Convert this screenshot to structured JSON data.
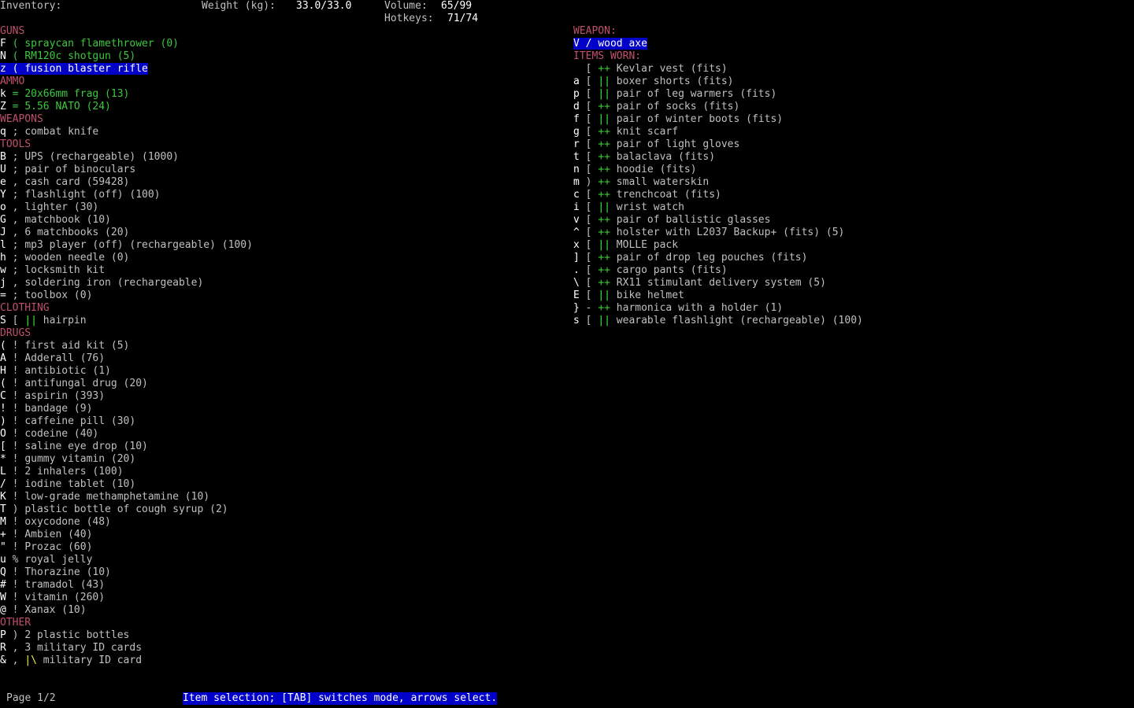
{
  "header": {
    "title": "Inventory:",
    "weight_label": "Weight (kg):",
    "weight_value": "33.0/33.0",
    "volume_label": "Volume:",
    "volume_value": "65/99",
    "hotkeys_label": "Hotkeys:",
    "hotkeys_value": "71/74"
  },
  "left": {
    "sections": [
      {
        "title": "GUNS",
        "items": [
          {
            "key": "F",
            "sym": "(",
            "text": "spraycan flamethrower (0)",
            "style": "green"
          },
          {
            "key": "N",
            "sym": "(",
            "text": "RM120c shotgun (5)",
            "style": "green"
          },
          {
            "key": "z",
            "sym": "(",
            "text": "fusion blaster rifle",
            "style": "selected"
          }
        ]
      },
      {
        "title": "AMMO",
        "items": [
          {
            "key": "k",
            "sym": "=",
            "text": "20x66mm frag (13)",
            "style": "green"
          },
          {
            "key": "Z",
            "sym": "=",
            "text": "5.56 NATO (24)",
            "style": "green"
          }
        ]
      },
      {
        "title": "WEAPONS",
        "items": [
          {
            "key": "q",
            "sym": ";",
            "text": "combat knife",
            "style": "normal"
          }
        ]
      },
      {
        "title": "TOOLS",
        "items": [
          {
            "key": "B",
            "sym": ";",
            "text": "UPS (rechargeable) (1000)",
            "style": "normal"
          },
          {
            "key": "U",
            "sym": ";",
            "text": "pair of binoculars",
            "style": "normal"
          },
          {
            "key": "e",
            "sym": ",",
            "text": "cash card (59428)",
            "style": "normal"
          },
          {
            "key": "Y",
            "sym": ";",
            "text": "flashlight (off) (100)",
            "style": "normal"
          },
          {
            "key": "o",
            "sym": ",",
            "text": "lighter (30)",
            "style": "normal"
          },
          {
            "key": "G",
            "sym": ",",
            "text": "matchbook (10)",
            "style": "normal"
          },
          {
            "key": "J",
            "sym": ",",
            "text": "6 matchbooks (20)",
            "style": "normal"
          },
          {
            "key": "l",
            "sym": ";",
            "text": "mp3 player (off) (rechargeable) (100)",
            "style": "normal"
          },
          {
            "key": "h",
            "sym": ";",
            "text": "wooden needle (0)",
            "style": "normal"
          },
          {
            "key": "w",
            "sym": ";",
            "text": "locksmith kit",
            "style": "normal"
          },
          {
            "key": "j",
            "sym": ",",
            "text": "soldering iron (rechargeable)",
            "style": "normal"
          },
          {
            "key": "=",
            "sym": ";",
            "text": "toolbox (0)",
            "style": "normal"
          }
        ]
      },
      {
        "title": "CLOTHING",
        "items": [
          {
            "key": "S",
            "sym": "[",
            "mark": "||",
            "mark_style": "bright-green",
            "text": "hairpin",
            "style": "normal"
          }
        ]
      },
      {
        "title": "DRUGS",
        "items": [
          {
            "key": "(",
            "sym": "!",
            "text": "first aid kit (5)",
            "style": "normal"
          },
          {
            "key": "A",
            "sym": "!",
            "text": "Adderall (76)",
            "style": "normal"
          },
          {
            "key": "H",
            "sym": "!",
            "text": "antibiotic (1)",
            "style": "normal"
          },
          {
            "key": "(",
            "sym": "!",
            "text": "antifungal drug (20)",
            "style": "normal"
          },
          {
            "key": "C",
            "sym": "!",
            "text": "aspirin (393)",
            "style": "normal"
          },
          {
            "key": "!",
            "sym": "!",
            "text": "bandage (9)",
            "style": "normal"
          },
          {
            "key": ")",
            "sym": "!",
            "text": "caffeine pill (30)",
            "style": "normal"
          },
          {
            "key": "O",
            "sym": "!",
            "text": "codeine (40)",
            "style": "normal"
          },
          {
            "key": "[",
            "sym": "!",
            "text": "saline eye drop (10)",
            "style": "normal"
          },
          {
            "key": "*",
            "sym": "!",
            "text": "gummy vitamin (20)",
            "style": "normal"
          },
          {
            "key": "L",
            "sym": "!",
            "text": "2 inhalers (100)",
            "style": "normal"
          },
          {
            "key": "/",
            "sym": "!",
            "text": "iodine tablet (10)",
            "style": "normal"
          },
          {
            "key": "K",
            "sym": "!",
            "text": "low-grade methamphetamine (10)",
            "style": "normal"
          },
          {
            "key": "T",
            "sym": ")",
            "text": "plastic bottle of cough syrup (2)",
            "style": "normal"
          },
          {
            "key": "M",
            "sym": "!",
            "text": "oxycodone (48)",
            "style": "normal"
          },
          {
            "key": "+",
            "sym": "!",
            "text": "Ambien (40)",
            "style": "normal"
          },
          {
            "key": "\"",
            "sym": "!",
            "text": "Prozac (60)",
            "style": "normal"
          },
          {
            "key": "u",
            "sym": "%",
            "text": "royal jelly",
            "style": "normal"
          },
          {
            "key": "Q",
            "sym": "!",
            "text": "Thorazine (10)",
            "style": "normal"
          },
          {
            "key": "#",
            "sym": "!",
            "text": "tramadol (43)",
            "style": "normal"
          },
          {
            "key": "W",
            "sym": "!",
            "text": "vitamin (260)",
            "style": "normal"
          },
          {
            "key": "@",
            "sym": "!",
            "text": "Xanax (10)",
            "style": "normal"
          }
        ]
      },
      {
        "title": "OTHER",
        "items": [
          {
            "key": "P",
            "sym": ")",
            "text": "2 plastic bottles",
            "style": "normal"
          },
          {
            "key": "R",
            "sym": ",",
            "text": "3 military ID cards",
            "style": "normal"
          },
          {
            "key": "&",
            "sym": ",",
            "mark": "|\\",
            "mark_style": "yellow",
            "text": "military ID card",
            "style": "normal"
          }
        ]
      }
    ]
  },
  "right": {
    "weapon_title": "WEAPON:",
    "weapon": {
      "key": "V",
      "sym": "/",
      "text": "wood axe"
    },
    "worn_title": "ITEMS WORN:",
    "worn": [
      {
        "key": " ",
        "sym": "[",
        "mark": "++",
        "text": "Kevlar vest (fits)"
      },
      {
        "key": "a",
        "sym": "[",
        "mark": "||",
        "text": "boxer shorts (fits)"
      },
      {
        "key": "p",
        "sym": "[",
        "mark": "||",
        "text": "pair of leg warmers (fits)"
      },
      {
        "key": "d",
        "sym": "[",
        "mark": "++",
        "text": "pair of socks (fits)"
      },
      {
        "key": "f",
        "sym": "[",
        "mark": "||",
        "text": "pair of winter boots (fits)"
      },
      {
        "key": "g",
        "sym": "[",
        "mark": "++",
        "text": "knit scarf"
      },
      {
        "key": "r",
        "sym": "[",
        "mark": "++",
        "text": "pair of light gloves"
      },
      {
        "key": "t",
        "sym": "[",
        "mark": "++",
        "text": "balaclava (fits)"
      },
      {
        "key": "n",
        "sym": "[",
        "mark": "++",
        "text": "hoodie (fits)"
      },
      {
        "key": "m",
        "sym": ")",
        "mark": "++",
        "text": "small waterskin"
      },
      {
        "key": "c",
        "sym": "[",
        "mark": "++",
        "text": "trenchcoat (fits)"
      },
      {
        "key": "i",
        "sym": "[",
        "mark": "||",
        "text": "wrist watch"
      },
      {
        "key": "v",
        "sym": "[",
        "mark": "++",
        "text": "pair of ballistic glasses"
      },
      {
        "key": "^",
        "sym": "[",
        "mark": "++",
        "text": "holster with L2037 Backup+ (fits) (5)"
      },
      {
        "key": "x",
        "sym": "[",
        "mark": "||",
        "text": "MOLLE pack"
      },
      {
        "key": "]",
        "sym": "[",
        "mark": "++",
        "text": "pair of drop leg pouches (fits)"
      },
      {
        "key": ".",
        "sym": "[",
        "mark": "++",
        "text": "cargo pants (fits)"
      },
      {
        "key": "\\",
        "sym": "[",
        "mark": "++",
        "text": "RX11 stimulant delivery system (5)"
      },
      {
        "key": "E",
        "sym": "[",
        "mark": "||",
        "text": "bike helmet"
      },
      {
        "key": "}",
        "sym": "-",
        "mark": "++",
        "text": "harmonica with a holder (1)"
      },
      {
        "key": "s",
        "sym": "[",
        "mark": "||",
        "text": "wearable flashlight (rechargeable) (100)"
      }
    ]
  },
  "footer": {
    "page": "Page 1/2",
    "status": "Item selection; [TAB] switches mode, arrows select."
  }
}
